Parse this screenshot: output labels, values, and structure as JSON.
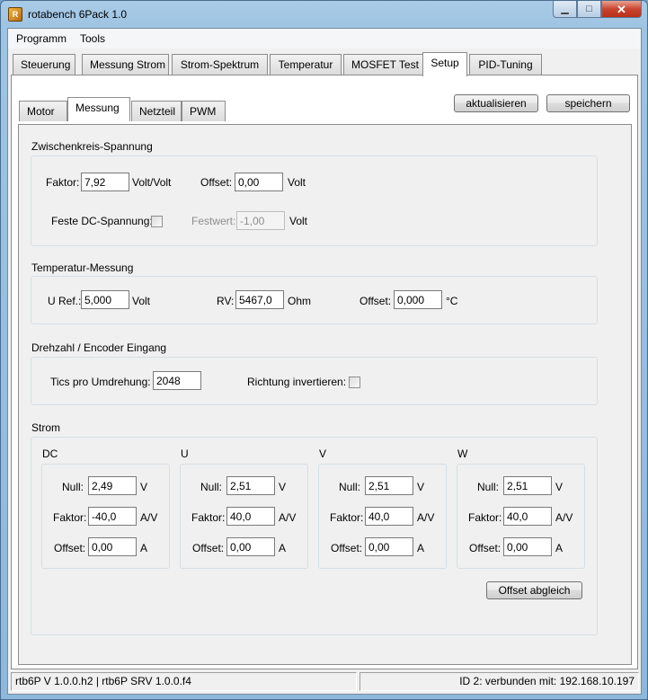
{
  "window": {
    "title": "rotabench 6Pack 1.0",
    "icon": "app-icon"
  },
  "menu": [
    "Programm",
    "Tools"
  ],
  "tabs": [
    "Steuerung",
    "Messung Strom",
    "Strom-Spektrum",
    "Temperatur",
    "MOSFET Test",
    "Setup",
    "PID-Tuning"
  ],
  "active_tab": "Setup",
  "subtabs": [
    "Motor",
    "Messung",
    "Netzteil",
    "PWM"
  ],
  "active_subtab": "Messung",
  "buttons": {
    "refresh": "aktualisieren",
    "save": "speichern",
    "offset_adjust": "Offset abgleich"
  },
  "zwischenkreis": {
    "title": "Zwischenkreis-Spannung",
    "faktor_label": "Faktor:",
    "faktor_value": "7,92",
    "faktor_unit": "Volt/Volt",
    "offset_label": "Offset:",
    "offset_value": "0,00",
    "offset_unit": "Volt",
    "feste_label": "Feste DC-Spannung:",
    "festwert_label": "Festwert:",
    "festwert_value": "-1,00",
    "festwert_unit": "Volt"
  },
  "temperatur": {
    "title": "Temperatur-Messung",
    "uref_label": "U Ref.:",
    "uref_value": "5,000",
    "uref_unit": "Volt",
    "rv_label": "RV:",
    "rv_value": "5467,0",
    "rv_unit": "Ohm",
    "offset_label": "Offset:",
    "offset_value": "0,000",
    "offset_unit": "°C"
  },
  "drehzahl": {
    "title": "Drehzahl / Encoder Eingang",
    "tics_label": "Tics pro Umdrehung:",
    "tics_value": "2048",
    "invert_label": "Richtung invertieren:"
  },
  "strom": {
    "title": "Strom",
    "channels": [
      {
        "name": "DC",
        "null": "2,49",
        "faktor": "-40,0",
        "offset": "0,00"
      },
      {
        "name": "U",
        "null": "2,51",
        "faktor": "40,0",
        "offset": "0,00"
      },
      {
        "name": "V",
        "null": "2,51",
        "faktor": "40,0",
        "offset": "0,00"
      },
      {
        "name": "W",
        "null": "2,51",
        "faktor": "40,0",
        "offset": "0,00"
      }
    ],
    "labels": {
      "null": "Null:",
      "faktor": "Faktor:",
      "offset": "Offset:"
    },
    "units": {
      "null": "V",
      "faktor": "A/V",
      "offset": "A"
    }
  },
  "status": {
    "left": "rtb6P V 1.0.0.h2 | rtb6P SRV 1.0.0.f4",
    "right": "ID 2: verbunden mit: 192.168.10.197"
  }
}
